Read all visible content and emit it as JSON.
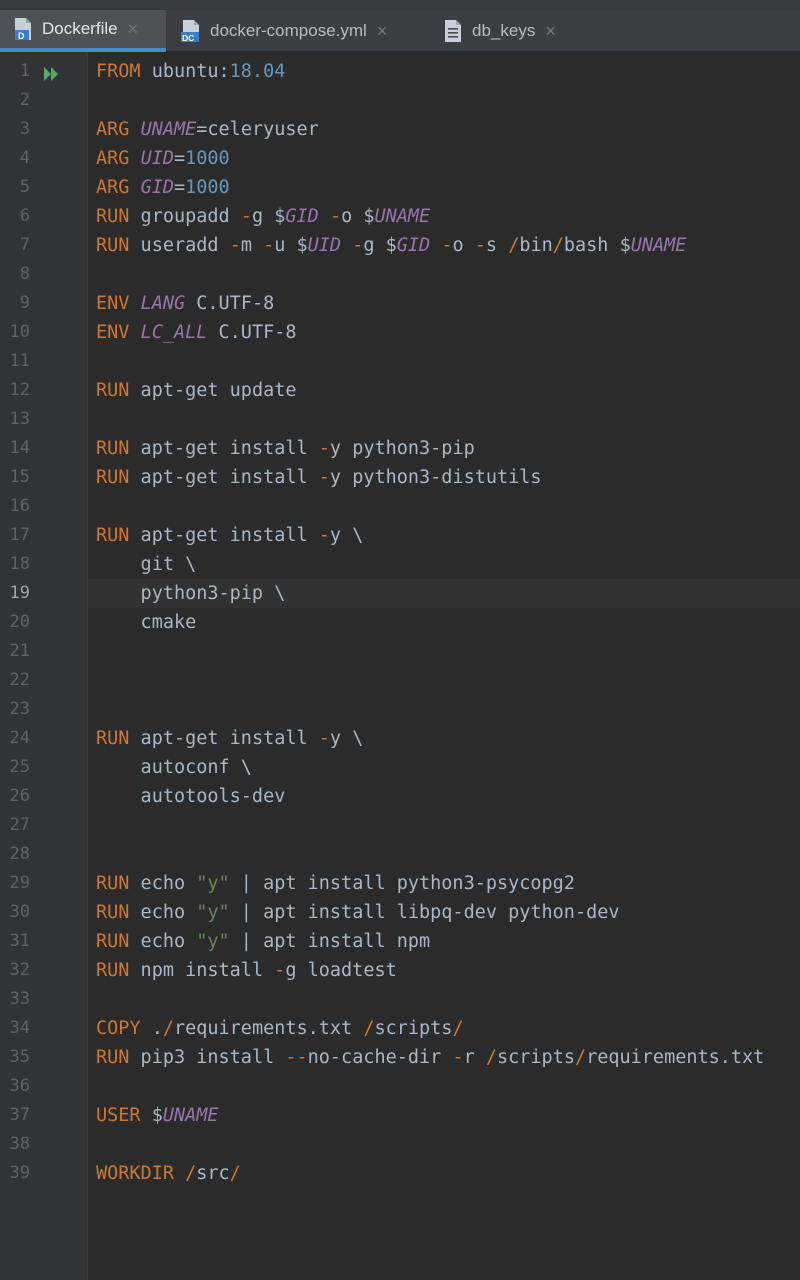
{
  "tabs": [
    {
      "label": "Dockerfile",
      "active": true,
      "icon": "dockerfile-icon",
      "badge": "D"
    },
    {
      "label": "docker-compose.yml",
      "active": false,
      "icon": "docker-compose-icon",
      "badge": "DC"
    },
    {
      "label": "db_keys",
      "active": false,
      "icon": "text-file-icon",
      "badge": ""
    }
  ],
  "close_glyph": "×",
  "current_line": 19,
  "colors": {
    "keyword": "#cc7832",
    "variable": "#9876aa",
    "number": "#6897bb",
    "string": "#6a8759",
    "text": "#a9b7c6",
    "accent": "#4a88c7"
  },
  "lines": [
    [
      [
        "kw",
        "FROM"
      ],
      [
        "t",
        " ubuntu:"
      ],
      [
        "num",
        "18.04"
      ]
    ],
    [],
    [
      [
        "kw",
        "ARG"
      ],
      [
        "t",
        " "
      ],
      [
        "var",
        "UNAME"
      ],
      [
        "t",
        "=celeryuser"
      ]
    ],
    [
      [
        "kw",
        "ARG"
      ],
      [
        "t",
        " "
      ],
      [
        "var",
        "UID"
      ],
      [
        "t",
        "="
      ],
      [
        "num",
        "1000"
      ]
    ],
    [
      [
        "kw",
        "ARG"
      ],
      [
        "t",
        " "
      ],
      [
        "var",
        "GID"
      ],
      [
        "t",
        "="
      ],
      [
        "num",
        "1000"
      ]
    ],
    [
      [
        "kw",
        "RUN"
      ],
      [
        "t",
        " groupadd "
      ],
      [
        "opt",
        "-"
      ],
      [
        "t",
        "g $"
      ],
      [
        "var",
        "GID"
      ],
      [
        "t",
        " "
      ],
      [
        "opt",
        "-"
      ],
      [
        "t",
        "o $"
      ],
      [
        "var",
        "UNAME"
      ]
    ],
    [
      [
        "kw",
        "RUN"
      ],
      [
        "t",
        " useradd "
      ],
      [
        "opt",
        "-"
      ],
      [
        "t",
        "m "
      ],
      [
        "opt",
        "-"
      ],
      [
        "t",
        "u $"
      ],
      [
        "var",
        "UID"
      ],
      [
        "t",
        " "
      ],
      [
        "opt",
        "-"
      ],
      [
        "t",
        "g $"
      ],
      [
        "var",
        "GID"
      ],
      [
        "t",
        " "
      ],
      [
        "opt",
        "-"
      ],
      [
        "t",
        "o "
      ],
      [
        "opt",
        "-"
      ],
      [
        "t",
        "s "
      ],
      [
        "opt",
        "/"
      ],
      [
        "t",
        "bin"
      ],
      [
        "opt",
        "/"
      ],
      [
        "t",
        "bash $"
      ],
      [
        "var",
        "UNAME"
      ]
    ],
    [],
    [
      [
        "kw",
        "ENV"
      ],
      [
        "t",
        " "
      ],
      [
        "var",
        "LANG"
      ],
      [
        "t",
        " C.UTF-8"
      ]
    ],
    [
      [
        "kw",
        "ENV"
      ],
      [
        "t",
        " "
      ],
      [
        "var",
        "LC_ALL"
      ],
      [
        "t",
        " C.UTF-8"
      ]
    ],
    [],
    [
      [
        "kw",
        "RUN"
      ],
      [
        "t",
        " apt-get update"
      ]
    ],
    [],
    [
      [
        "kw",
        "RUN"
      ],
      [
        "t",
        " apt-get install "
      ],
      [
        "opt",
        "-"
      ],
      [
        "t",
        "y python3-pip"
      ]
    ],
    [
      [
        "kw",
        "RUN"
      ],
      [
        "t",
        " apt-get install "
      ],
      [
        "opt",
        "-"
      ],
      [
        "t",
        "y python3-distutils"
      ]
    ],
    [],
    [
      [
        "kw",
        "RUN"
      ],
      [
        "t",
        " apt-get install "
      ],
      [
        "opt",
        "-"
      ],
      [
        "t",
        "y \\"
      ]
    ],
    [
      [
        "t",
        "    git \\"
      ]
    ],
    [
      [
        "t",
        "    python3-pip \\"
      ]
    ],
    [
      [
        "t",
        "    cmake"
      ]
    ],
    [],
    [],
    [],
    [
      [
        "kw",
        "RUN"
      ],
      [
        "t",
        " apt-get install "
      ],
      [
        "opt",
        "-"
      ],
      [
        "t",
        "y \\"
      ]
    ],
    [
      [
        "t",
        "    autoconf \\"
      ]
    ],
    [
      [
        "t",
        "    autotools-dev"
      ]
    ],
    [],
    [],
    [
      [
        "kw",
        "RUN"
      ],
      [
        "t",
        " echo "
      ],
      [
        "str",
        "\"y\""
      ],
      [
        "t",
        " | apt install python3-psycopg2"
      ]
    ],
    [
      [
        "kw",
        "RUN"
      ],
      [
        "t",
        " echo "
      ],
      [
        "str",
        "\"y\""
      ],
      [
        "t",
        " | apt install libpq-dev python-dev"
      ]
    ],
    [
      [
        "kw",
        "RUN"
      ],
      [
        "t",
        " echo "
      ],
      [
        "str",
        "\"y\""
      ],
      [
        "t",
        " | apt install npm"
      ]
    ],
    [
      [
        "kw",
        "RUN"
      ],
      [
        "t",
        " npm install "
      ],
      [
        "opt",
        "-"
      ],
      [
        "t",
        "g loadtest"
      ]
    ],
    [],
    [
      [
        "kw",
        "COPY"
      ],
      [
        "t",
        " ."
      ],
      [
        "opt",
        "/"
      ],
      [
        "t",
        "requirements.txt "
      ],
      [
        "opt",
        "/"
      ],
      [
        "t",
        "scripts"
      ],
      [
        "opt",
        "/"
      ]
    ],
    [
      [
        "kw",
        "RUN"
      ],
      [
        "t",
        " pip3 install "
      ],
      [
        "opt",
        "--"
      ],
      [
        "t",
        "no-cache-dir "
      ],
      [
        "opt",
        "-"
      ],
      [
        "t",
        "r "
      ],
      [
        "opt",
        "/"
      ],
      [
        "t",
        "scripts"
      ],
      [
        "opt",
        "/"
      ],
      [
        "t",
        "requirements.txt"
      ]
    ],
    [],
    [
      [
        "kw",
        "USER"
      ],
      [
        "t",
        " $"
      ],
      [
        "var",
        "UNAME"
      ]
    ],
    [],
    [
      [
        "kw",
        "WORKDIR"
      ],
      [
        "t",
        " "
      ],
      [
        "opt",
        "/"
      ],
      [
        "t",
        "src"
      ],
      [
        "opt",
        "/"
      ]
    ]
  ]
}
